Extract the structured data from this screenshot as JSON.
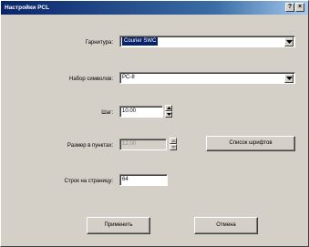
{
  "window": {
    "title": "Настройки PCL",
    "help_button": "?",
    "close_button": "×"
  },
  "form": {
    "typeface": {
      "label": "Гарнитура:",
      "value": "Courier SWC"
    },
    "symbol_set": {
      "label": "Набор символов:",
      "value": "PC-8"
    },
    "pitch": {
      "label": "Шаг:",
      "value": "10.00"
    },
    "point_size": {
      "label": "Размер в пунктах:",
      "value": "12.00",
      "enabled": false
    },
    "font_list_button": "Список шрифтов",
    "lines_per_page": {
      "label": "Строк на страницу:",
      "value": "64"
    }
  },
  "buttons": {
    "apply": "Применить",
    "cancel": "Отмена"
  },
  "colors": {
    "titlebar_start": "#0a246a",
    "titlebar_end": "#a6caf0",
    "dialog_face": "#d4d0c8",
    "selection": "#0a246a"
  }
}
